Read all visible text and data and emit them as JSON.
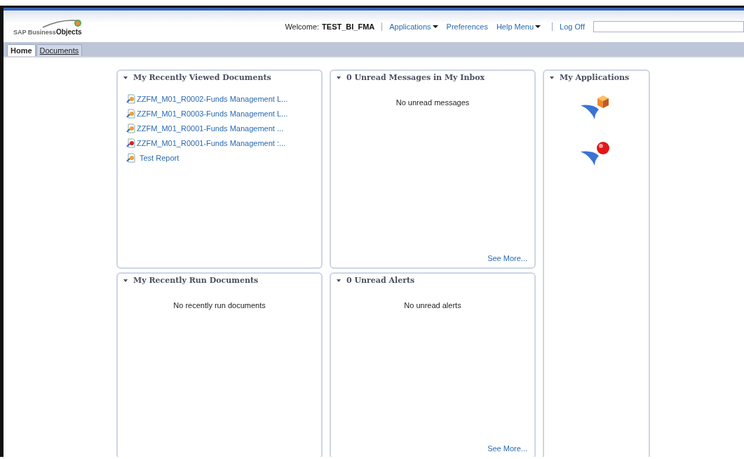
{
  "header": {
    "logo": {
      "word1": "SAP Business",
      "word2": "Objects"
    },
    "welcome_label": "Welcome:",
    "user": "TEST_BI_FMA",
    "nav": [
      {
        "label": "Applications",
        "dropdown": true
      },
      {
        "label": "Preferences",
        "dropdown": false
      },
      {
        "label": "Help Menu",
        "dropdown": true
      },
      {
        "label": "Log Off",
        "dropdown": false
      }
    ]
  },
  "tabs": [
    {
      "label": "Home",
      "selected": true
    },
    {
      "label": "Documents",
      "selected": false
    }
  ],
  "panels": {
    "recently_viewed": {
      "title": "My Recently Viewed Documents",
      "expanded": true,
      "documents": [
        {
          "name": "ZZFM_M01_R0002-Funds Management L...",
          "kind": "standard"
        },
        {
          "name": "ZZFM_M01_R0003-Funds Management L...",
          "kind": "standard"
        },
        {
          "name": "ZZFM_M01_R0001-Funds Management ...",
          "kind": "standard"
        },
        {
          "name": "ZZFM_M01_R0001-Funds Management :...",
          "kind": "flagged"
        },
        {
          "name": "Test Report",
          "kind": "standard"
        }
      ]
    },
    "inbox": {
      "title": "0 Unread Messages in My Inbox",
      "expanded": true,
      "message": "No unread messages",
      "link": "See More..."
    },
    "applications": {
      "title": "My Applications",
      "expanded": true,
      "apps": [
        {
          "kind": "cube"
        },
        {
          "kind": "sphere"
        }
      ]
    },
    "recently_run": {
      "title": "My Recently Run Documents",
      "expanded": true,
      "message": "No recently run documents"
    },
    "alerts": {
      "title": "0 Unread Alerts",
      "expanded": true,
      "message": "No unread alerts",
      "link": "See More..."
    }
  }
}
